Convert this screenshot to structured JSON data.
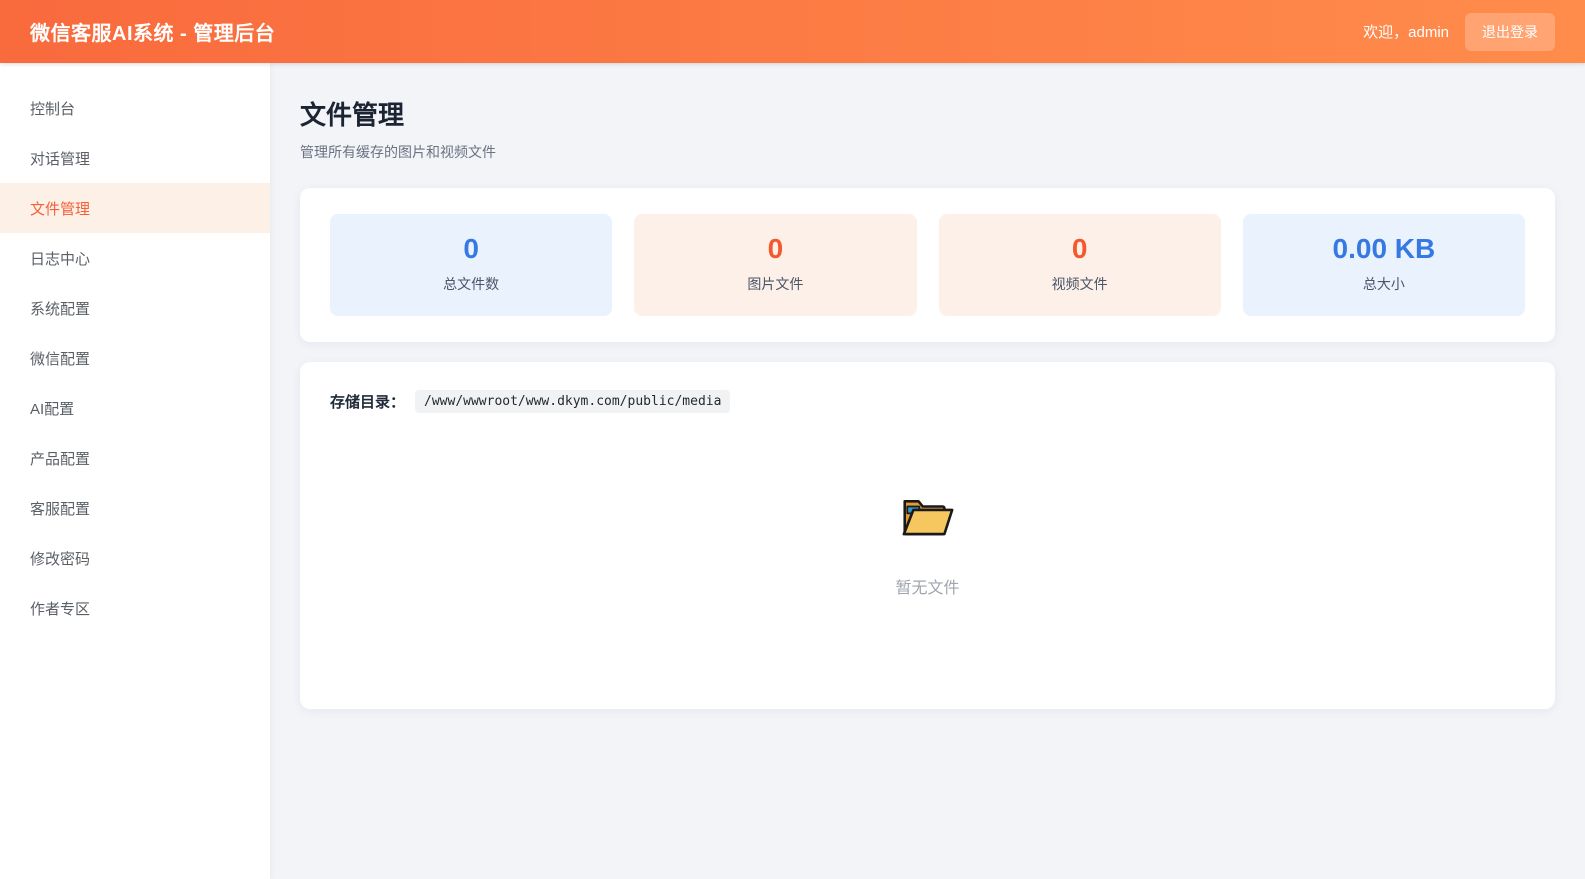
{
  "header": {
    "title": "微信客服AI系统 - 管理后台",
    "welcome": "欢迎，admin",
    "logout_label": "退出登录"
  },
  "sidebar": {
    "items": [
      {
        "label": "控制台"
      },
      {
        "label": "对话管理"
      },
      {
        "label": "文件管理",
        "active": true
      },
      {
        "label": "日志中心"
      },
      {
        "label": "系统配置"
      },
      {
        "label": "微信配置"
      },
      {
        "label": "AI配置"
      },
      {
        "label": "产品配置"
      },
      {
        "label": "客服配置"
      },
      {
        "label": "修改密码"
      },
      {
        "label": "作者专区"
      }
    ]
  },
  "page": {
    "title": "文件管理",
    "subtitle": "管理所有缓存的图片和视频文件"
  },
  "stats": [
    {
      "value": "0",
      "label": "总文件数",
      "theme": "blue"
    },
    {
      "value": "0",
      "label": "图片文件",
      "theme": "orange"
    },
    {
      "value": "0",
      "label": "视频文件",
      "theme": "orange"
    },
    {
      "value": "0.00 KB",
      "label": "总大小",
      "theme": "blue"
    }
  ],
  "storage": {
    "label": "存储目录：",
    "path": "/www/wwwroot/www.dkym.com/public/media"
  },
  "empty_state": {
    "icon": "open-folder-icon",
    "text": "暂无文件"
  },
  "colors": {
    "header_gradient_start": "#f96a3d",
    "header_gradient_end": "#ff8c4b",
    "active_menu_bg": "#fdf1e7",
    "active_menu_text": "#f4603a",
    "stat_blue_bg": "#e9f2fd",
    "stat_blue_text": "#3779e3",
    "stat_orange_bg": "#fdf0e8",
    "stat_orange_text": "#f4582e"
  }
}
